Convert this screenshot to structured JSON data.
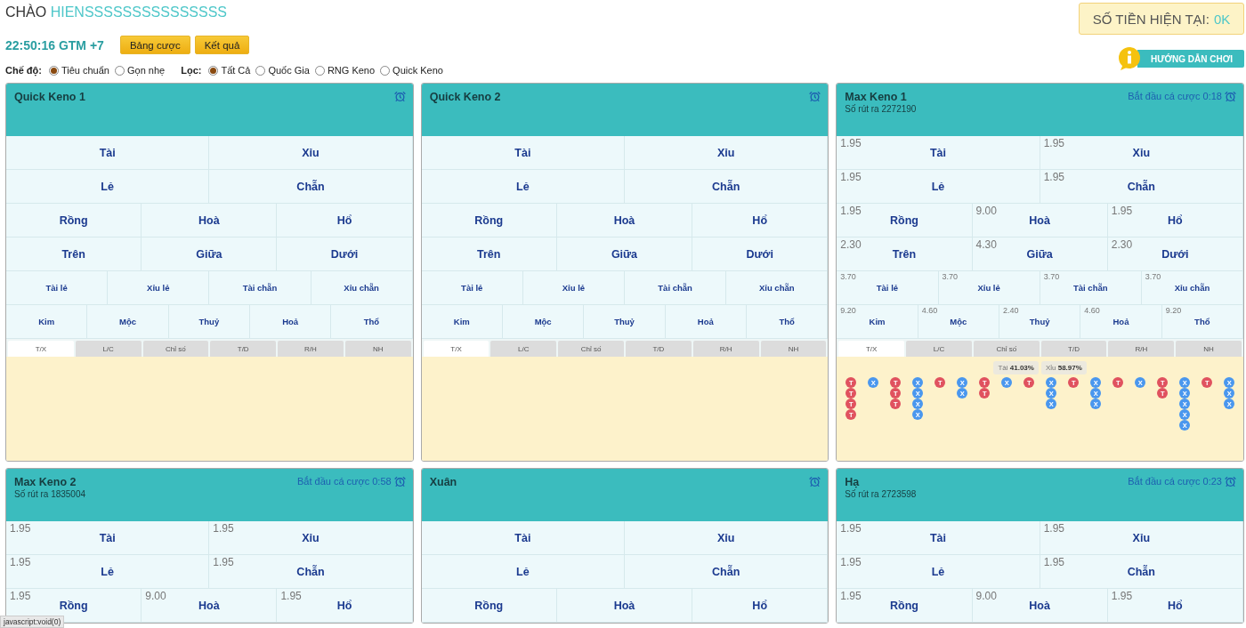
{
  "greeting": {
    "prefix": "CHÀO",
    "user": "HIENSSSSSSSSSSSSSSS"
  },
  "balance": {
    "label": "SỐ TIỀN HIỆN TẠI:",
    "value": "0K"
  },
  "clock": "22:50:16 GTM +7",
  "buttons": [
    "Bảng cược",
    "Kết quả"
  ],
  "help_button": "HƯỚNG DẪN CHƠI",
  "mode": {
    "label": "Chế độ:",
    "options": [
      {
        "label": "Tiêu chuẩn",
        "selected": true
      },
      {
        "label": "Gọn nhẹ",
        "selected": false
      }
    ]
  },
  "filter": {
    "label": "Lọc:",
    "options": [
      {
        "label": "Tất Cả",
        "selected": true
      },
      {
        "label": "Quốc Gia",
        "selected": false
      },
      {
        "label": "RNG Keno",
        "selected": false
      },
      {
        "label": "Quick Keno",
        "selected": false
      }
    ]
  },
  "cards": [
    {
      "title": "Quick Keno 1",
      "bet_groups": [
        {
          "options": [
            {
              "label": "Tài"
            },
            {
              "label": "Xỉu"
            }
          ]
        },
        {
          "options": [
            {
              "label": "Lẻ"
            },
            {
              "label": "Chẵn"
            }
          ]
        },
        {
          "options": [
            {
              "label": "Rồng"
            },
            {
              "label": "Hoà"
            },
            {
              "label": "Hổ"
            }
          ]
        },
        {
          "options": [
            {
              "label": "Trên"
            },
            {
              "label": "Giữa"
            },
            {
              "label": "Dưới"
            }
          ]
        },
        {
          "options": [
            {
              "label": "Tài lẻ"
            },
            {
              "label": "Xỉu lẻ"
            },
            {
              "label": "Tài chẵn"
            },
            {
              "label": "Xỉu chẵn"
            }
          ]
        },
        {
          "options": [
            {
              "label": "Kim"
            },
            {
              "label": "Mộc"
            },
            {
              "label": "Thuỷ"
            },
            {
              "label": "Hoả"
            },
            {
              "label": "Thổ"
            }
          ]
        }
      ],
      "tabs": [
        {
          "label": "T/X",
          "selected": true
        },
        {
          "label": "L/C",
          "selected": false
        },
        {
          "label": "Chỉ số",
          "selected": false
        },
        {
          "label": "T/D",
          "selected": false
        },
        {
          "label": "R/H",
          "selected": false
        },
        {
          "label": "NH",
          "selected": false
        }
      ]
    },
    {
      "title": "Quick Keno 2",
      "bet_groups": [
        {
          "options": [
            {
              "label": "Tài"
            },
            {
              "label": "Xỉu"
            }
          ]
        },
        {
          "options": [
            {
              "label": "Lẻ"
            },
            {
              "label": "Chẵn"
            }
          ]
        },
        {
          "options": [
            {
              "label": "Rồng"
            },
            {
              "label": "Hoà"
            },
            {
              "label": "Hổ"
            }
          ]
        },
        {
          "options": [
            {
              "label": "Trên"
            },
            {
              "label": "Giữa"
            },
            {
              "label": "Dưới"
            }
          ]
        },
        {
          "options": [
            {
              "label": "Tài lẻ"
            },
            {
              "label": "Xỉu lẻ"
            },
            {
              "label": "Tài chẵn"
            },
            {
              "label": "Xỉu chẵn"
            }
          ]
        },
        {
          "options": [
            {
              "label": "Kim"
            },
            {
              "label": "Mộc"
            },
            {
              "label": "Thuỷ"
            },
            {
              "label": "Hoả"
            },
            {
              "label": "Thổ"
            }
          ]
        }
      ],
      "tabs": [
        {
          "label": "T/X",
          "selected": true
        },
        {
          "label": "L/C",
          "selected": false
        },
        {
          "label": "Chỉ số",
          "selected": false
        },
        {
          "label": "T/D",
          "selected": false
        },
        {
          "label": "R/H",
          "selected": false
        },
        {
          "label": "NH",
          "selected": false
        }
      ]
    },
    {
      "title": "Max Keno 1",
      "subtitle": "Số rút ra 2272190",
      "timer": "Bắt đầu cá cược 0:18",
      "bet_groups": [
        {
          "options": [
            {
              "label": "Tài",
              "odds": "1.95"
            },
            {
              "label": "Xỉu",
              "odds": "1.95"
            }
          ]
        },
        {
          "options": [
            {
              "label": "Lẻ",
              "odds": "1.95"
            },
            {
              "label": "Chẵn",
              "odds": "1.95"
            }
          ]
        },
        {
          "options": [
            {
              "label": "Rồng",
              "odds": "1.95"
            },
            {
              "label": "Hoà",
              "odds": "9.00"
            },
            {
              "label": "Hổ",
              "odds": "1.95"
            }
          ]
        },
        {
          "options": [
            {
              "label": "Trên",
              "odds": "2.30"
            },
            {
              "label": "Giữa",
              "odds": "4.30"
            },
            {
              "label": "Dưới",
              "odds": "2.30"
            }
          ]
        },
        {
          "options": [
            {
              "label": "Tài lẻ",
              "odds": "3.70"
            },
            {
              "label": "Xỉu lẻ",
              "odds": "3.70"
            },
            {
              "label": "Tài chẵn",
              "odds": "3.70"
            },
            {
              "label": "Xỉu chẵn",
              "odds": "3.70"
            }
          ]
        },
        {
          "options": [
            {
              "label": "Kim",
              "odds": "9.20"
            },
            {
              "label": "Mộc",
              "odds": "4.60"
            },
            {
              "label": "Thuỷ",
              "odds": "2.40"
            },
            {
              "label": "Hoả",
              "odds": "4.60"
            },
            {
              "label": "Thổ",
              "odds": "9.20"
            }
          ]
        }
      ],
      "tabs": [
        {
          "label": "T/X",
          "selected": true
        },
        {
          "label": "L/C",
          "selected": false
        },
        {
          "label": "Chỉ số",
          "selected": false
        },
        {
          "label": "T/D",
          "selected": false
        },
        {
          "label": "R/H",
          "selected": false
        },
        {
          "label": "NH",
          "selected": false
        }
      ],
      "stats": [
        "Tài **41.03%**",
        "Xỉu **58.97%**"
      ],
      "road": [
        [
          {
            "label": "T",
            "color": "#e0525f"
          },
          {
            "label": "T",
            "color": "#e0525f"
          },
          {
            "label": "T",
            "color": "#e0525f"
          },
          {
            "label": "T",
            "color": "#e0525f"
          }
        ],
        [
          {
            "label": "X",
            "color": "#4a97ee"
          }
        ],
        [
          {
            "label": "T",
            "color": "#e0525f"
          },
          {
            "label": "T",
            "color": "#e0525f"
          },
          {
            "label": "T",
            "color": "#e0525f"
          }
        ],
        [
          {
            "label": "X",
            "color": "#4a97ee"
          },
          {
            "label": "X",
            "color": "#4a97ee"
          },
          {
            "label": "X",
            "color": "#4a97ee"
          },
          {
            "label": "X",
            "color": "#4a97ee"
          }
        ],
        [
          {
            "label": "T",
            "color": "#e0525f"
          }
        ],
        [
          {
            "label": "X",
            "color": "#4a97ee"
          },
          {
            "label": "X",
            "color": "#4a97ee"
          }
        ],
        [
          {
            "label": "T",
            "color": "#e0525f"
          },
          {
            "label": "T",
            "color": "#e0525f"
          }
        ],
        [
          {
            "label": "X",
            "color": "#4a97ee"
          }
        ],
        [
          {
            "label": "T",
            "color": "#e0525f"
          }
        ],
        [
          {
            "label": "X",
            "color": "#4a97ee"
          },
          {
            "label": "X",
            "color": "#4a97ee"
          },
          {
            "label": "X",
            "color": "#4a97ee"
          }
        ],
        [
          {
            "label": "T",
            "color": "#e0525f"
          }
        ],
        [
          {
            "label": "X",
            "color": "#4a97ee"
          },
          {
            "label": "X",
            "color": "#4a97ee"
          },
          {
            "label": "X",
            "color": "#4a97ee"
          }
        ],
        [
          {
            "label": "T",
            "color": "#e0525f"
          }
        ],
        [
          {
            "label": "X",
            "color": "#4a97ee"
          }
        ],
        [
          {
            "label": "T",
            "color": "#e0525f"
          },
          {
            "label": "T",
            "color": "#e0525f"
          }
        ],
        [
          {
            "label": "X",
            "color": "#4a97ee"
          },
          {
            "label": "X",
            "color": "#4a97ee"
          },
          {
            "label": "X",
            "color": "#4a97ee"
          },
          {
            "label": "X",
            "color": "#4a97ee"
          },
          {
            "label": "X",
            "color": "#4a97ee"
          }
        ],
        [
          {
            "label": "T",
            "color": "#e0525f"
          }
        ],
        [
          {
            "label": "X",
            "color": "#4a97ee"
          },
          {
            "label": "X",
            "color": "#4a97ee"
          },
          {
            "label": "X",
            "color": "#4a97ee"
          }
        ]
      ]
    },
    {
      "title": "Max Keno 2",
      "subtitle": "Số rút ra 1835004",
      "timer": "Bắt đầu cá cược 0:58",
      "bet_groups": [
        {
          "options": [
            {
              "label": "Tài",
              "odds": "1.95"
            },
            {
              "label": "Xỉu",
              "odds": "1.95"
            }
          ]
        },
        {
          "options": [
            {
              "label": "Lẻ",
              "odds": "1.95"
            },
            {
              "label": "Chẵn",
              "odds": "1.95"
            }
          ]
        },
        {
          "options": [
            {
              "label": "Rồng",
              "odds": "1.95"
            },
            {
              "label": "Hoà",
              "odds": "9.00"
            },
            {
              "label": "Hổ",
              "odds": "1.95"
            }
          ]
        }
      ]
    },
    {
      "title": "Xuân",
      "bet_groups": [
        {
          "options": [
            {
              "label": "Tài"
            },
            {
              "label": "Xỉu"
            }
          ]
        },
        {
          "options": [
            {
              "label": "Lẻ"
            },
            {
              "label": "Chẵn"
            }
          ]
        },
        {
          "options": [
            {
              "label": "Rồng"
            },
            {
              "label": "Hoà"
            },
            {
              "label": "Hổ"
            }
          ]
        }
      ]
    },
    {
      "title": "Hạ",
      "subtitle": "Số rút ra 2723598",
      "timer": "Bắt đầu cá cược 0:23",
      "bet_groups": [
        {
          "options": [
            {
              "label": "Tài",
              "odds": "1.95"
            },
            {
              "label": "Xỉu",
              "odds": "1.95"
            }
          ]
        },
        {
          "options": [
            {
              "label": "Lẻ",
              "odds": "1.95"
            },
            {
              "label": "Chẵn",
              "odds": "1.95"
            }
          ]
        },
        {
          "options": [
            {
              "label": "Rồng",
              "odds": "1.95"
            },
            {
              "label": "Hoà",
              "odds": "9.00"
            },
            {
              "label": "Hổ",
              "odds": "1.95"
            }
          ]
        }
      ]
    }
  ],
  "status_bar": "javascript:void(0)"
}
